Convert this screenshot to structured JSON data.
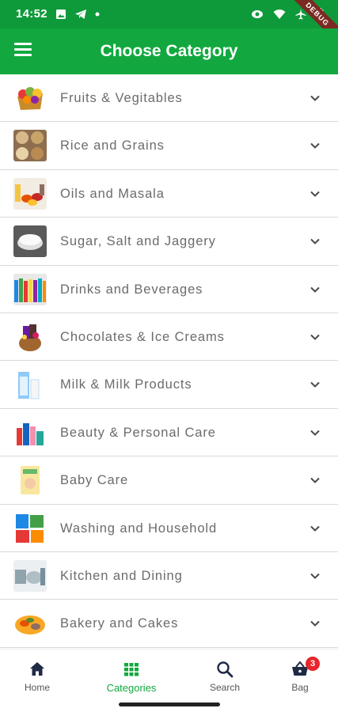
{
  "status_bar": {
    "time": "14:52",
    "left_icons": [
      "image-icon",
      "telegram-icon",
      "dot-icon"
    ],
    "right_icons": [
      "eye-icon",
      "wifi-icon",
      "airplane-icon",
      "battery-icon"
    ],
    "debug_banner": "DEBUG"
  },
  "app_bar": {
    "title": "Choose Category",
    "menu_icon": "hamburger-menu-icon",
    "background": "#12a83f"
  },
  "categories": [
    {
      "label": "Fruits & Vegitables",
      "thumb_icon": "fruit-basket-image"
    },
    {
      "label": "Rice and Grains",
      "thumb_icon": "grain-bowls-image"
    },
    {
      "label": "Oils and Masala",
      "thumb_icon": "spices-image"
    },
    {
      "label": "Sugar, Salt and Jaggery",
      "thumb_icon": "sugar-bowl-image"
    },
    {
      "label": "Drinks and Beverages",
      "thumb_icon": "drink-bottles-image"
    },
    {
      "label": "Chocolates & Ice Creams",
      "thumb_icon": "chocolate-basket-image"
    },
    {
      "label": "Milk & Milk Products",
      "thumb_icon": "milk-carton-image"
    },
    {
      "label": "Beauty & Personal Care",
      "thumb_icon": "cosmetics-image"
    },
    {
      "label": "Baby Care",
      "thumb_icon": "diaper-pack-image"
    },
    {
      "label": "Washing and Household",
      "thumb_icon": "detergent-image"
    },
    {
      "label": "Kitchen and Dining",
      "thumb_icon": "kitchenware-image"
    },
    {
      "label": "Bakery and Cakes",
      "thumb_icon": "bakery-image"
    }
  ],
  "bottom_nav": {
    "items": [
      {
        "label": "Home",
        "icon": "home-icon",
        "active": false
      },
      {
        "label": "Categories",
        "icon": "grid-icon",
        "active": true
      },
      {
        "label": "Search",
        "icon": "search-icon",
        "active": false
      },
      {
        "label": "Bag",
        "icon": "shopping-basket-icon",
        "active": false,
        "badge": "3"
      }
    ]
  },
  "colors": {
    "primary": "#12a83f",
    "status_bar": "#0e9a3a",
    "badge": "#e8262b",
    "label_text": "#6b6b6b"
  }
}
